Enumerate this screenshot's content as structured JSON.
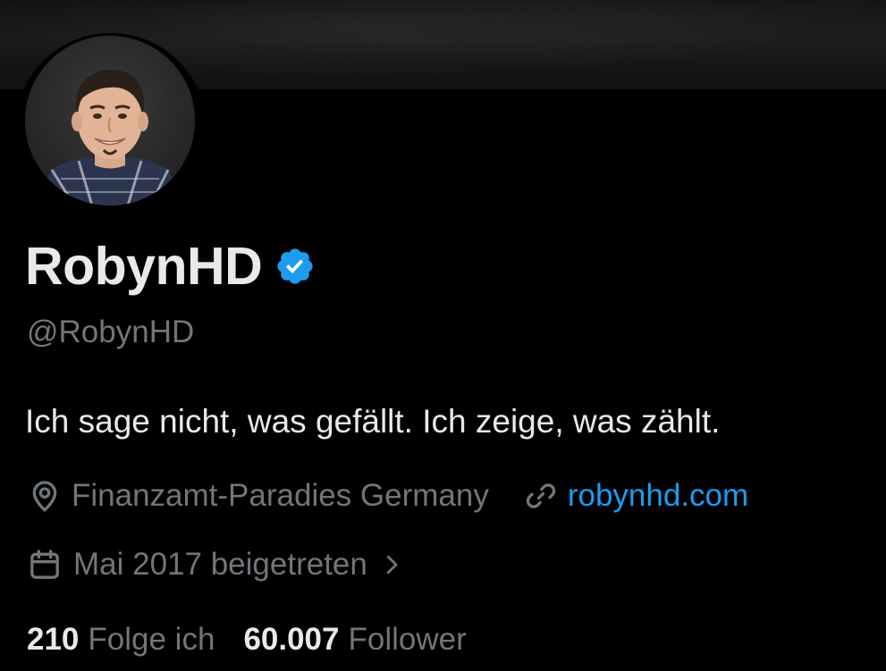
{
  "profile": {
    "display_name": "RobynHD",
    "handle": "@RobynHD",
    "verified_icon": "verified-badge-icon",
    "bio": "Ich sage nicht, was gefällt. Ich zeige, was zählt.",
    "location": "Finanzamt-Paradies Germany",
    "website": "robynhd.com",
    "joined": "Mai 2017 beigetreten",
    "stats": {
      "following_count": "210",
      "following_label": "Folge ich",
      "followers_count": "60.007",
      "followers_label": "Follower"
    }
  },
  "colors": {
    "background": "#000000",
    "primary_text": "#e7e9ea",
    "secondary_text": "#71767b",
    "accent": "#1d9bf0"
  }
}
